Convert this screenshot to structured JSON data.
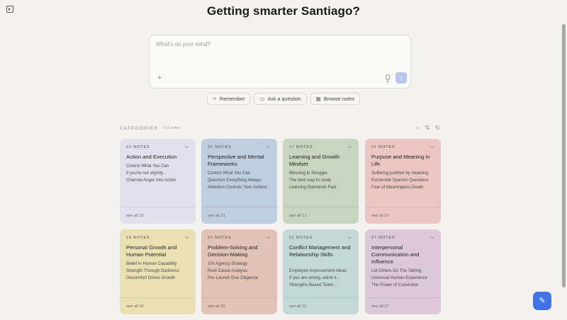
{
  "heading": "Getting smarter Santiago?",
  "composer": {
    "placeholder": "What's on your mind?"
  },
  "actions": [
    {
      "label": "Remember",
      "icon": "✧"
    },
    {
      "label": "Ask a question",
      "icon": "▭"
    },
    {
      "label": "Browse notes",
      "icon": "▦"
    }
  ],
  "categories_header": {
    "title": "CATEGORIES",
    "count": "167 notes"
  },
  "categories": [
    {
      "count": "22 NOTES",
      "title": "Action and Execution",
      "color": "#e3e0ee",
      "notes": [
        "Control What You Can",
        "If you're not slightly...",
        "Channel Anger Into Action"
      ],
      "see_all": "see all 22"
    },
    {
      "count": "21 NOTES",
      "title": "Perspective and Mental Frameworks",
      "color": "#c0cfe0",
      "notes": [
        "Control What You Can",
        "Question Everything Always",
        "Attention Controls Your Actions"
      ],
      "see_all": "see all 21"
    },
    {
      "count": "17 NOTES",
      "title": "Learning and Growth Mindset",
      "color": "#c8d5c1",
      "notes": [
        "Blessing in Struggle",
        "The best way to study",
        "Learning Diamonds Fast"
      ],
      "see_all": "see all 17"
    },
    {
      "count": "21 NOTES",
      "title": "Purpose and Meaning in Life",
      "color": "#ecc6c3",
      "notes": [
        "Suffering justified by meaning.",
        "Existential Spanish Questions",
        "Fear of Meaningless Death"
      ],
      "see_all": "see all 21"
    },
    {
      "count": "16 NOTES",
      "title": "Personal Growth and Human Potential",
      "color": "#eae0b4",
      "notes": [
        "Belief in Human Capability",
        "Strength Through Darkness",
        "Discomfort Drives Growth"
      ],
      "see_all": "see all 16"
    },
    {
      "count": "22 NOTES",
      "title": "Problem-Solving and Decision-Making",
      "color": "#e2c3b6",
      "notes": [
        "10x Agency Strategy",
        "Root Cause Analysis",
        "Pre-Launch Due Diligence"
      ],
      "see_all": "see all 22"
    },
    {
      "count": "11 NOTES",
      "title": "Conflict Management and Relationship Skills",
      "color": "#c3d9d8",
      "notes": [
        "Employee Improvement Ideas",
        "If you are wrong, admit it...",
        "Strengths-Based Team..."
      ],
      "see_all": "see all 11"
    },
    {
      "count": "27 NOTES",
      "title": "Interpersonal Communication and Influence",
      "color": "#dcc8d9",
      "notes": [
        "Let Others Do The Talking",
        "Universal Human Experience",
        "The Power of Conviction"
      ],
      "see_all": "see all 27"
    }
  ],
  "colors": {
    "accent": "#3f73e6",
    "send_button": "#b9c6ee",
    "background": "#f3f2ee"
  },
  "icons": {
    "sidebar_toggle": "sidebar-toggle-icon",
    "add": "plus-icon",
    "mic": "microphone-icon",
    "send": "arrow-up-icon",
    "search": "search-icon",
    "sort": "sort-icon",
    "refresh": "refresh-icon",
    "card_arrow": "arrow-right-icon",
    "new_note": "pencil-icon"
  }
}
